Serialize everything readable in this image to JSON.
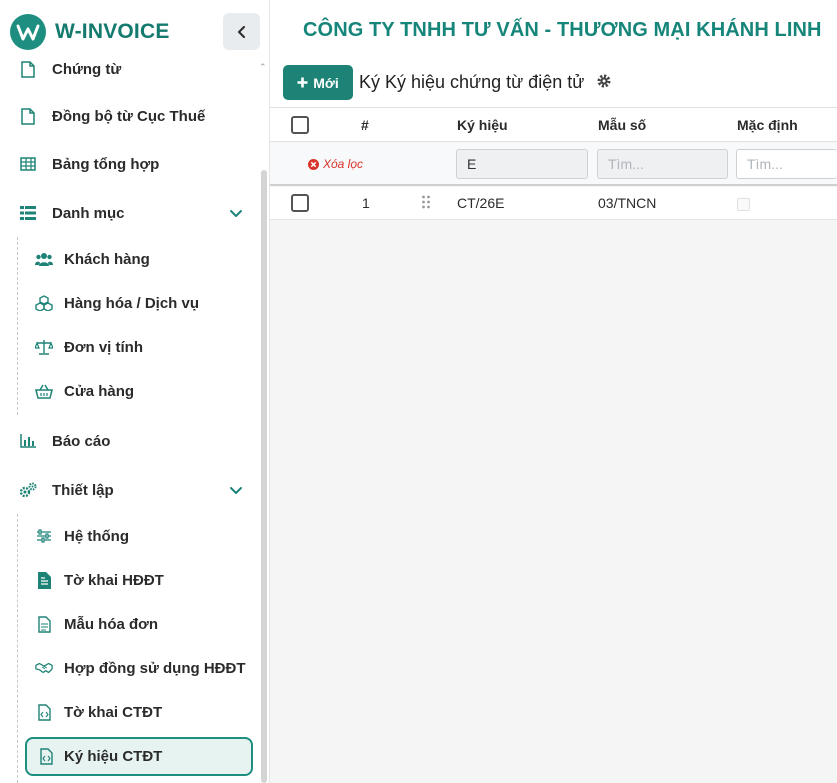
{
  "brand": {
    "name": "W-INVOICE"
  },
  "colors": {
    "primary": "#1e8377",
    "accent": "#16857a",
    "danger": "#d9342b"
  },
  "sidebar": {
    "items": [
      {
        "label": "Chứng từ",
        "icon": "file-icon"
      },
      {
        "label": "Đồng bộ từ Cục Thuế",
        "icon": "file-icon"
      },
      {
        "label": "Bảng tổng hợp",
        "icon": "table-icon"
      },
      {
        "label": "Danh mục",
        "icon": "list-icon",
        "expanded": true
      },
      {
        "label": "Khách hàng",
        "icon": "users-icon"
      },
      {
        "label": "Hàng hóa / Dịch vụ",
        "icon": "cubes-icon"
      },
      {
        "label": "Đơn vị tính",
        "icon": "scale-icon"
      },
      {
        "label": "Cửa hàng",
        "icon": "basket-icon"
      },
      {
        "label": "Báo cáo",
        "icon": "bar-chart-icon"
      },
      {
        "label": "Thiết lập",
        "icon": "gears-icon",
        "expanded": true
      },
      {
        "label": "Hệ thống",
        "icon": "sliders-icon"
      },
      {
        "label": "Tờ khai HĐĐT",
        "icon": "file-text-icon"
      },
      {
        "label": "Mẫu hóa đơn",
        "icon": "file-lines-icon"
      },
      {
        "label": "Hợp đồng sử dụng HĐĐT",
        "icon": "handshake-icon"
      },
      {
        "label": "Tờ khai CTĐT",
        "icon": "file-code-icon"
      },
      {
        "label": "Ký hiệu CTĐT",
        "icon": "file-code-icon",
        "active": true
      }
    ]
  },
  "header": {
    "company": "CÔNG TY TNHH TƯ VẤN - THƯƠNG MẠI KHÁNH LINH"
  },
  "toolbar": {
    "new_label": "Mới",
    "title": "Ký Ký hiệu chứng từ điện tử"
  },
  "grid": {
    "columns": [
      "#",
      "Ký hiệu",
      "Mẫu số",
      "Mặc định"
    ],
    "clear_filter": "Xóa lọc",
    "filters": {
      "ky_hieu": "E",
      "mau_so_placeholder": "Tìm...",
      "mac_dinh_placeholder": "Tìm..."
    },
    "rows": [
      {
        "index": "1",
        "ky_hieu": "CT/26E",
        "mau_so": "03/TNCN",
        "mac_dinh": false
      }
    ]
  }
}
